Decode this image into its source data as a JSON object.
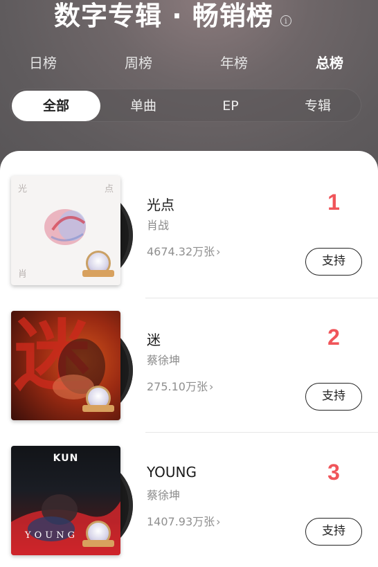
{
  "header": {
    "title": "数字专辑 · 畅销榜",
    "info_icon": "info-icon"
  },
  "period_tabs": [
    {
      "label": "日榜",
      "active": false
    },
    {
      "label": "周榜",
      "active": false
    },
    {
      "label": "年榜",
      "active": false
    },
    {
      "label": "总榜",
      "active": true
    }
  ],
  "type_tabs": [
    {
      "label": "全部",
      "active": true
    },
    {
      "label": "单曲",
      "active": false
    },
    {
      "label": "EP",
      "active": false
    },
    {
      "label": "专辑",
      "active": false
    }
  ],
  "albums": [
    {
      "rank": "1",
      "name": "光点",
      "artist": "肖战",
      "sales": "4674.32万张",
      "support_label": "支持",
      "cover_text": {
        "top_left": "光",
        "top_right": "点",
        "bottom_left": "肖"
      }
    },
    {
      "rank": "2",
      "name": "迷",
      "artist": "蔡徐坤",
      "sales": "275.10万张",
      "support_label": "支持",
      "cover_text": {
        "big": "迷"
      }
    },
    {
      "rank": "3",
      "name": "YOUNG",
      "artist": "蔡徐坤",
      "sales": "1407.93万张",
      "support_label": "支持",
      "cover_text": {
        "logo": "KUN",
        "word": "YOUNG"
      }
    }
  ],
  "colors": {
    "rank": "#f0555a",
    "header_bg": "#5f5b5d"
  }
}
